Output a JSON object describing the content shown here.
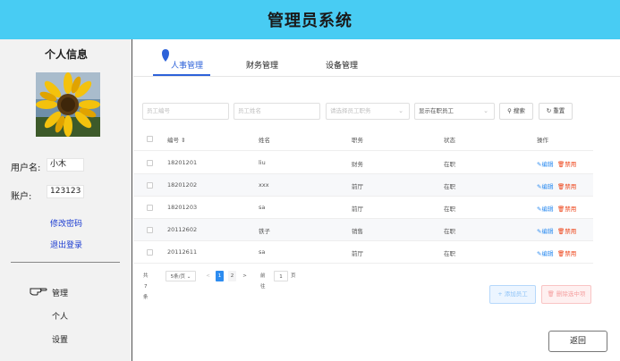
{
  "header": {
    "title": "管理员系统"
  },
  "sidebar": {
    "title": "个人信息",
    "username_label": "用户名:",
    "username_value": "小木",
    "account_label": "账户:",
    "account_value": "123123",
    "change_password": "修改密码",
    "logout": "退出登录",
    "menu": {
      "manage": "管理",
      "personal": "个人",
      "settings": "设置"
    }
  },
  "tabs": [
    "人事管理",
    "财务管理",
    "设备管理"
  ],
  "filters": {
    "emp_no_placeholder": "员工编号",
    "emp_name_placeholder": "员工姓名",
    "position_placeholder": "请选择员工职务",
    "status_value": "显示在职员工",
    "search_label": "搜索",
    "reset_label": "重置"
  },
  "table": {
    "headers": [
      "编号 ⇕",
      "姓名",
      "职务",
      "状态",
      "操作"
    ],
    "rows": [
      [
        "18201201",
        "liu",
        "财务",
        "在职"
      ],
      [
        "18201202",
        "xxx",
        "前厅",
        "在职"
      ],
      [
        "18201203",
        "sa",
        "前厅",
        "在职"
      ],
      [
        "20112602",
        "铁子",
        "销售",
        "在职"
      ],
      [
        "20112611",
        "sa",
        "前厅",
        "在职"
      ]
    ],
    "edit_label": "编辑",
    "ban_label": "禁用"
  },
  "pager": {
    "total": "共7条",
    "page_size": "5条/页",
    "prev": "<",
    "pages": [
      "1",
      "2"
    ],
    "next": ">",
    "goto_label": "前往",
    "goto_value": "1",
    "page_unit": "页"
  },
  "actions": {
    "add": "+ 添加员工",
    "delete_selected": "删除选中项",
    "back": "返回"
  },
  "colors": {
    "header": "#48ccf3",
    "accent": "#2d8cf0",
    "danger": "#ed4014"
  }
}
